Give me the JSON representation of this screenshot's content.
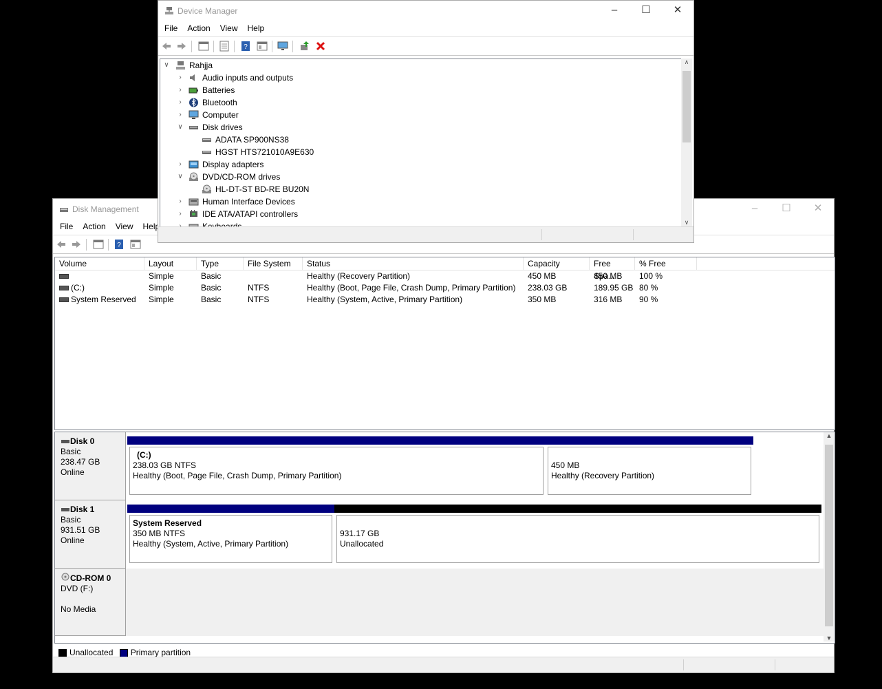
{
  "disk_management": {
    "title": "Disk Management",
    "menu": [
      "File",
      "Action",
      "View",
      "Help"
    ],
    "columns": [
      "Volume",
      "Layout",
      "Type",
      "File System",
      "Status",
      "Capacity",
      "Free Spa...",
      "% Free"
    ],
    "volumes": [
      {
        "volume": "",
        "layout": "Simple",
        "type": "Basic",
        "fs": "",
        "status": "Healthy (Recovery Partition)",
        "capacity": "450 MB",
        "free": "450 MB",
        "pct": "100 %"
      },
      {
        "volume": "(C:)",
        "layout": "Simple",
        "type": "Basic",
        "fs": "NTFS",
        "status": "Healthy (Boot, Page File, Crash Dump, Primary Partition)",
        "capacity": "238.03 GB",
        "free": "189.95 GB",
        "pct": "80 %"
      },
      {
        "volume": "System Reserved",
        "layout": "Simple",
        "type": "Basic",
        "fs": "NTFS",
        "status": "Healthy (System, Active, Primary Partition)",
        "capacity": "350 MB",
        "free": "316 MB",
        "pct": "90 %"
      }
    ],
    "disks": [
      {
        "name": "Disk 0",
        "type": "Basic",
        "size": "238.47 GB",
        "state": "Online",
        "parts": [
          {
            "title": "(C:)",
            "size": "238.03 GB NTFS",
            "status": "Healthy (Boot, Page File, Crash Dump, Primary Partition)"
          },
          {
            "title": "",
            "size": "450 MB",
            "status": "Healthy (Recovery Partition)"
          }
        ]
      },
      {
        "name": "Disk 1",
        "type": "Basic",
        "size": "931.51 GB",
        "state": "Online",
        "parts": [
          {
            "title": "System Reserved",
            "size": "350 MB NTFS",
            "status": "Healthy (System, Active, Primary Partition)"
          },
          {
            "title": "",
            "size": "931.17 GB",
            "status": "Unallocated"
          }
        ]
      },
      {
        "name": "CD-ROM 0",
        "type": "DVD (F:)",
        "size": "",
        "state": "No Media",
        "parts": []
      }
    ],
    "legend": [
      {
        "label": "Unallocated",
        "color": "#000000"
      },
      {
        "label": "Primary partition",
        "color": "#00007f"
      }
    ]
  },
  "device_manager": {
    "title": "Device Manager",
    "menu": [
      "File",
      "Action",
      "View",
      "Help"
    ],
    "root": "Rahjja",
    "tree": [
      {
        "label": "Audio inputs and outputs",
        "level": 1,
        "state": "collapsed",
        "icon": "speaker-icon"
      },
      {
        "label": "Batteries",
        "level": 1,
        "state": "collapsed",
        "icon": "battery-icon"
      },
      {
        "label": "Bluetooth",
        "level": 1,
        "state": "collapsed",
        "icon": "bluetooth-icon"
      },
      {
        "label": "Computer",
        "level": 1,
        "state": "collapsed",
        "icon": "monitor-icon"
      },
      {
        "label": "Disk drives",
        "level": 1,
        "state": "expanded",
        "icon": "disk-drive-icon"
      },
      {
        "label": "ADATA SP900NS38",
        "level": 2,
        "state": "leaf",
        "icon": "disk-drive-icon"
      },
      {
        "label": "HGST HTS721010A9E630",
        "level": 2,
        "state": "leaf",
        "icon": "disk-drive-icon"
      },
      {
        "label": "Display adapters",
        "level": 1,
        "state": "collapsed",
        "icon": "display-adapter-icon"
      },
      {
        "label": "DVD/CD-ROM drives",
        "level": 1,
        "state": "expanded",
        "icon": "optical-drive-icon"
      },
      {
        "label": "HL-DT-ST BD-RE BU20N",
        "level": 2,
        "state": "leaf",
        "icon": "optical-drive-icon"
      },
      {
        "label": "Human Interface Devices",
        "level": 1,
        "state": "collapsed",
        "icon": "hid-icon"
      },
      {
        "label": "IDE ATA/ATAPI controllers",
        "level": 1,
        "state": "collapsed",
        "icon": "controller-icon"
      },
      {
        "label": "Keyboards",
        "level": 1,
        "state": "collapsed",
        "icon": "keyboard-icon"
      }
    ]
  }
}
